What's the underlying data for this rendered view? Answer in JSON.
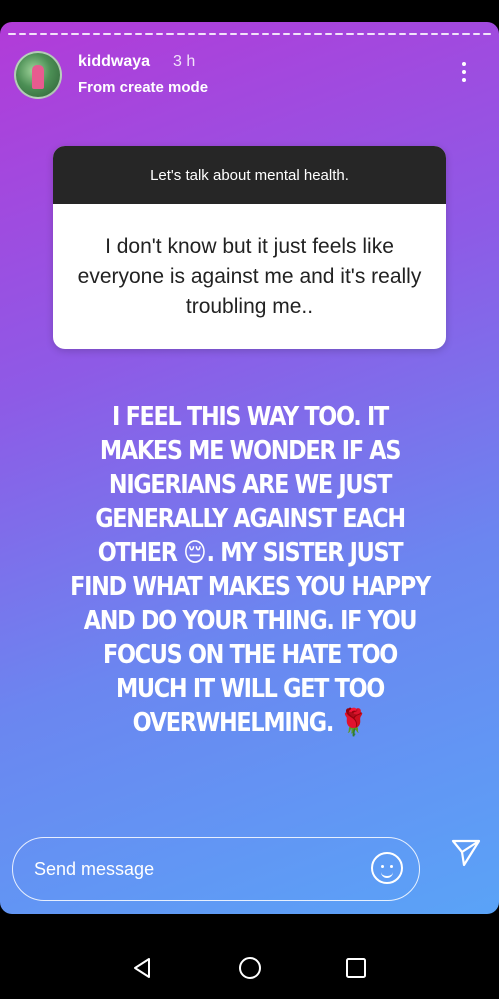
{
  "header": {
    "username": "kiddwaya",
    "time": "3 h",
    "subtitle": "From create mode"
  },
  "question_card": {
    "prompt": "Let's talk about mental health.",
    "response": "I don't know but it just feels like everyone is against me and it's really troubling me.."
  },
  "answer": {
    "part1": "I FEEL THIS WAY TOO. IT MAKES ME WONDER IF AS NIGERIANS ARE WE JUST GENERALLY AGAINST EACH OTHER",
    "emoji1": "😔",
    "part2": ".  MY SISTER JUST FIND WHAT MAKES YOU HAPPY AND DO YOUR THING. IF YOU FOCUS ON THE HATE TOO MUCH IT WILL GET TOO OVERWHELMING.",
    "emoji2": "🌹"
  },
  "footer": {
    "message_placeholder": "Send message"
  },
  "icons": {
    "menu": "more-vertical-icon",
    "sticker": "sticker-smile-icon",
    "send": "paper-plane-icon",
    "back": "back-triangle-icon",
    "home": "home-circle-icon",
    "recents": "recents-square-icon"
  },
  "colors": {
    "gradient_start": "#b23bd8",
    "gradient_end": "#5aa3f7",
    "card_header": "#262626"
  }
}
